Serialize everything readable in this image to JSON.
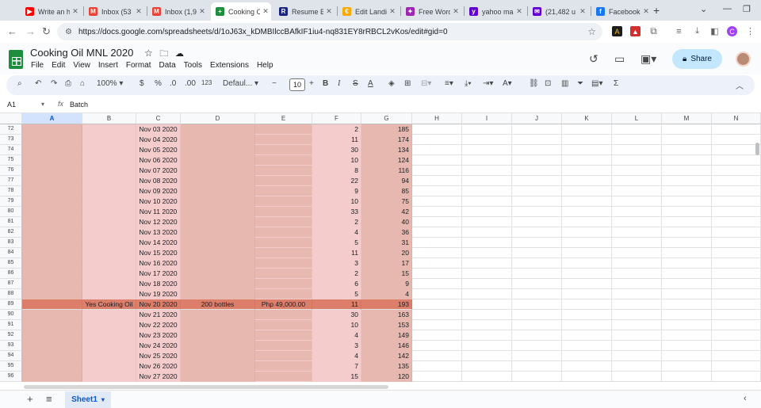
{
  "browser": {
    "tabs": [
      {
        "title": "Write an h",
        "icon": "youtube-icon",
        "color": "#ff0000",
        "glyph": "▶"
      },
      {
        "title": "Inbox (53",
        "icon": "gmail-icon",
        "color": "#ea4335",
        "glyph": "M"
      },
      {
        "title": "Inbox (1,9",
        "icon": "gmail-icon",
        "color": "#ea4335",
        "glyph": "M"
      },
      {
        "title": "Cooking C",
        "icon": "sheets-icon",
        "color": "#1e8e3e",
        "glyph": "+"
      },
      {
        "title": "Resume Bu",
        "icon": "resume-icon",
        "color": "#1a237e",
        "glyph": "R"
      },
      {
        "title": "Edit Landi",
        "icon": "edit-icon",
        "color": "#f9ab00",
        "glyph": "€"
      },
      {
        "title": "Free Word",
        "icon": "wordcloud-icon",
        "color": "#9c27b0",
        "glyph": "✦"
      },
      {
        "title": "yahoo ma",
        "icon": "yahoo-icon",
        "color": "#6001d2",
        "glyph": "y"
      },
      {
        "title": "(21,482 u",
        "icon": "yahoo-mail-icon",
        "color": "#6001d2",
        "glyph": "✉"
      },
      {
        "title": "Facebook",
        "icon": "facebook-icon",
        "color": "#1877f2",
        "glyph": "f"
      }
    ],
    "new_tab": "+",
    "url": "https://docs.google.com/spreadsheets/d/1oJ63x_kDMBIlccBAfkIF1iu4-nq831EY8rRBCL2vKos/edit#gid=0",
    "profile_initial": "C"
  },
  "doc": {
    "title": "Cooking Oil MNL 2020",
    "menu": [
      "File",
      "Edit",
      "View",
      "Insert",
      "Format",
      "Data",
      "Tools",
      "Extensions",
      "Help"
    ],
    "share_label": "Share"
  },
  "toolbar": {
    "zoom": "100%",
    "currency": "$",
    "percent": "%",
    "dec_decrease": ".0",
    "dec_increase": ".00",
    "number_format": "123",
    "font": "Defaul...",
    "font_size": "10",
    "minus": "−",
    "plus": "+",
    "bold": "B",
    "italic": "I",
    "strike": "S",
    "underline_a": "A",
    "sigma": "Σ"
  },
  "formula": {
    "cell_ref": "A1",
    "fx": "fx",
    "value": "Batch"
  },
  "columns": [
    "A",
    "B",
    "C",
    "D",
    "E",
    "F",
    "G",
    "H",
    "I",
    "J",
    "K",
    "L",
    "M",
    "N"
  ],
  "rows": [
    {
      "n": "72",
      "c": "Nov 03 2020",
      "f": "2",
      "g": "185"
    },
    {
      "n": "73",
      "c": "Nov 04 2020",
      "f": "11",
      "g": "174"
    },
    {
      "n": "74",
      "c": "Nov 05 2020",
      "f": "30",
      "g": "134"
    },
    {
      "n": "75",
      "c": "Nov 06 2020",
      "f": "10",
      "g": "124"
    },
    {
      "n": "76",
      "c": "Nov 07 2020",
      "f": "8",
      "g": "116"
    },
    {
      "n": "77",
      "c": "Nov 08 2020",
      "f": "22",
      "g": "94"
    },
    {
      "n": "78",
      "c": "Nov 09 2020",
      "f": "9",
      "g": "85"
    },
    {
      "n": "79",
      "c": "Nov 10 2020",
      "f": "10",
      "g": "75"
    },
    {
      "n": "80",
      "c": "Nov 11 2020",
      "f": "33",
      "g": "42"
    },
    {
      "n": "81",
      "c": "Nov 12 2020",
      "f": "2",
      "g": "40"
    },
    {
      "n": "82",
      "c": "Nov 13 2020",
      "f": "4",
      "g": "36"
    },
    {
      "n": "83",
      "c": "Nov 14 2020",
      "f": "5",
      "g": "31"
    },
    {
      "n": "84",
      "c": "Nov 15 2020",
      "f": "11",
      "g": "20"
    },
    {
      "n": "85",
      "c": "Nov 16 2020",
      "f": "3",
      "g": "17"
    },
    {
      "n": "86",
      "c": "Nov 17 2020",
      "f": "2",
      "g": "15"
    },
    {
      "n": "87",
      "c": "Nov 18 2020",
      "f": "6",
      "g": "9"
    },
    {
      "n": "88",
      "c": "Nov 19 2020",
      "f": "5",
      "g": "4"
    },
    {
      "n": "89",
      "b": "Yes Cooking Oil",
      "c": "Nov 20 2020",
      "d": "200 bottles",
      "e": "Php 49,000.00",
      "f": "11",
      "g": "193",
      "highlight": true
    },
    {
      "n": "90",
      "c": "Nov 21 2020",
      "f": "30",
      "g": "163"
    },
    {
      "n": "91",
      "c": "Nov 22 2020",
      "f": "10",
      "g": "153"
    },
    {
      "n": "92",
      "c": "Nov 23 2020",
      "f": "4",
      "g": "149"
    },
    {
      "n": "93",
      "c": "Nov 24 2020",
      "f": "3",
      "g": "146"
    },
    {
      "n": "94",
      "c": "Nov 25 2020",
      "f": "4",
      "g": "142"
    },
    {
      "n": "95",
      "c": "Nov 26 2020",
      "f": "7",
      "g": "135"
    },
    {
      "n": "96",
      "c": "Nov 27 2020",
      "f": "15",
      "g": "120"
    }
  ],
  "sheet": {
    "tab_label": "Sheet1",
    "add": "+",
    "list": "≡"
  },
  "colors": {
    "col_a_fill": "#e6b8af",
    "col_b_fill": "#f4cccc",
    "highlight_row": "#dd7e6b",
    "share_button": "#c2e7ff"
  }
}
